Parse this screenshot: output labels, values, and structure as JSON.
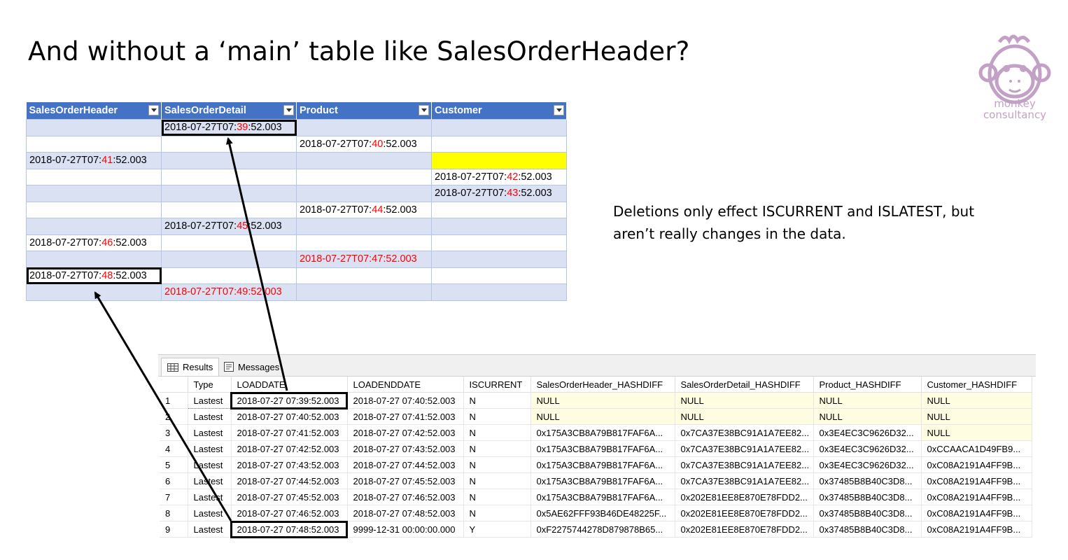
{
  "title": "And without a ‘main’ table like SalesOrderHeader?",
  "logo": {
    "line1": "monkey",
    "line2": "consultancy",
    "color": "#c3a1c6",
    "icon": "monkey-face-icon"
  },
  "note": {
    "line1": "Deletions only effect ISCURRENT and ISLATEST, but",
    "line2": "aren’t really changes in the data."
  },
  "excel": {
    "headers": [
      "SalesOrderHeader",
      "SalesOrderDetail",
      "Product",
      "Customer"
    ],
    "rows": [
      {
        "cells": [
          "",
          "2018-07-27T07:|39|:52.003",
          "",
          ""
        ]
      },
      {
        "cells": [
          "",
          "",
          "2018-07-27T07:|40|:52.003",
          ""
        ]
      },
      {
        "cells": [
          "2018-07-27T07:|41|:52.003",
          "",
          "",
          ""
        ]
      },
      {
        "cells": [
          "",
          "",
          "",
          "2018-07-27T07:|42|:52.003"
        ]
      },
      {
        "cells": [
          "",
          "",
          "",
          "2018-07-27T07:|43|:52.003"
        ]
      },
      {
        "cells": [
          "",
          "",
          "2018-07-27T07:|44|:52.003",
          ""
        ]
      },
      {
        "cells": [
          "",
          "2018-07-27T07:|45|:52.003",
          "",
          ""
        ]
      },
      {
        "cells": [
          "2018-07-27T07:|46|:52.003",
          "",
          "",
          ""
        ]
      },
      {
        "cells": [
          "",
          "",
          "2018-07-27T07:47:52.003",
          ""
        ]
      },
      {
        "cells": [
          "2018-07-27T07:|48|:52.003",
          "",
          "",
          ""
        ]
      },
      {
        "cells": [
          "",
          "2018-07-27T07:49:52.003",
          "",
          ""
        ]
      }
    ],
    "header_color": "#4472c4",
    "band_color": "#d9e1f2",
    "highlight_color": "#ffff00",
    "red": "#ff0000"
  },
  "ssms": {
    "tabs": [
      {
        "label": "Results",
        "icon": "grid-icon"
      },
      {
        "label": "Messages",
        "icon": "messages-icon"
      }
    ],
    "columns": [
      "",
      "Type",
      "LOADDATE",
      "LOADENDDATE",
      "ISCURRENT",
      "SalesOrderHeader_HASHDIFF",
      "SalesOrderDetail_HASHDIFF",
      "Product_HASHDIFF",
      "Customer_HASHDIFF"
    ],
    "rows": [
      [
        "1",
        "Lastest",
        "2018-07-27 07:39:52.003",
        "2018-07-27 07:40:52.003",
        "N",
        "NULL",
        "NULL",
        "NULL",
        "NULL"
      ],
      [
        "2",
        "Lastest",
        "2018-07-27 07:40:52.003",
        "2018-07-27 07:41:52.003",
        "N",
        "NULL",
        "NULL",
        "NULL",
        "NULL"
      ],
      [
        "3",
        "Lastest",
        "2018-07-27 07:41:52.003",
        "2018-07-27 07:42:52.003",
        "N",
        "0x175A3CB8A79B817FAF6A...",
        "0x7CA37E38BC91A1A7EE82...",
        "0x3E4EC3C9626D32...",
        "NULL"
      ],
      [
        "4",
        "Lastest",
        "2018-07-27 07:42:52.003",
        "2018-07-27 07:43:52.003",
        "N",
        "0x175A3CB8A79B817FAF6A...",
        "0x7CA37E38BC91A1A7EE82...",
        "0x3E4EC3C9626D32...",
        "0xCCAACA1D49FB9..."
      ],
      [
        "5",
        "Lastest",
        "2018-07-27 07:43:52.003",
        "2018-07-27 07:44:52.003",
        "N",
        "0x175A3CB8A79B817FAF6A...",
        "0x7CA37E38BC91A1A7EE82...",
        "0x3E4EC3C9626D32...",
        "0xC08A2191A4FF9B..."
      ],
      [
        "6",
        "Lastest",
        "2018-07-27 07:44:52.003",
        "2018-07-27 07:45:52.003",
        "N",
        "0x175A3CB8A79B817FAF6A...",
        "0x7CA37E38BC91A1A7EE82...",
        "0x37485B8B40C3D8...",
        "0xC08A2191A4FF9B..."
      ],
      [
        "7",
        "Lastest",
        "2018-07-27 07:45:52.003",
        "2018-07-27 07:46:52.003",
        "N",
        "0x175A3CB8A79B817FAF6A...",
        "0x202E81EE8E870E78FDD2...",
        "0x37485B8B40C3D8...",
        "0xC08A2191A4FF9B..."
      ],
      [
        "8",
        "Lastest",
        "2018-07-27 07:46:52.003",
        "2018-07-27 07:48:52.003",
        "N",
        "0x5AE62FFF93B46DE48225F...",
        "0x202E81EE8E870E78FDD2...",
        "0x37485B8B40C3D8...",
        "0xC08A2191A4FF9B..."
      ],
      [
        "9",
        "Lastest",
        "2018-07-27 07:48:52.003",
        "9999-12-31 00:00:00.000",
        "Y",
        "0xF2275744278D879878B65...",
        "0x202E81EE8E870E78FDD2...",
        "0x37485B8B40C3D8...",
        "0xC08A2191A4FF9B..."
      ]
    ],
    "null_color": "#fffde1"
  }
}
